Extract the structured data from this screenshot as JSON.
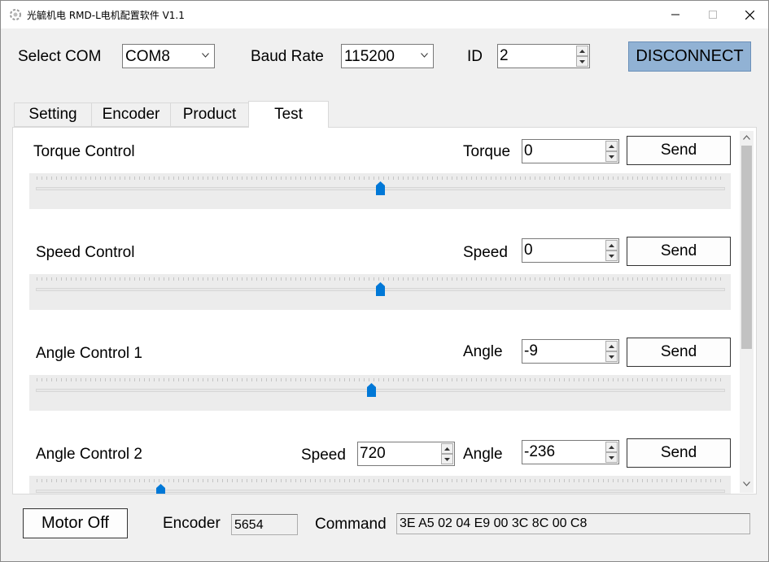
{
  "window": {
    "title": "光毓机电 RMD-L电机配置软件 V1.1",
    "controls": {
      "minimize": "—",
      "maximize": "☐",
      "close": "✕"
    }
  },
  "connection": {
    "com_label": "Select COM",
    "com_value": "COM8",
    "baud_label": "Baud Rate",
    "baud_value": "115200",
    "id_label": "ID",
    "id_value": "2",
    "disconnect_label": "DISCONNECT"
  },
  "tabs": [
    {
      "label": "Setting",
      "active": false
    },
    {
      "label": "Encoder",
      "active": false
    },
    {
      "label": "Product",
      "active": false
    },
    {
      "label": "Test",
      "active": true
    }
  ],
  "test": {
    "send_label": "Send",
    "torque": {
      "title": "Torque Control",
      "field_label": "Torque",
      "value": "0",
      "slider_fraction": 0.5
    },
    "speed": {
      "title": "Speed Control",
      "field_label": "Speed",
      "value": "0",
      "slider_fraction": 0.5
    },
    "angle1": {
      "title": "Angle Control 1",
      "field_label": "Angle",
      "value": "-9",
      "slider_fraction": 0.487
    },
    "angle2": {
      "title": "Angle Control 2",
      "speed_label": "Speed",
      "speed_value": "720",
      "angle_label": "Angle",
      "angle_value": "-236",
      "slider_fraction": 0.177
    }
  },
  "footer": {
    "motor_off_label": "Motor Off",
    "encoder_label": "Encoder",
    "encoder_value": "5654",
    "command_label": "Command",
    "command_value": "3E A5 02 04 E9 00 3C 8C 00 C8"
  },
  "colors": {
    "accent": "#0078d7",
    "disconnect_bg": "#91b2d4"
  }
}
